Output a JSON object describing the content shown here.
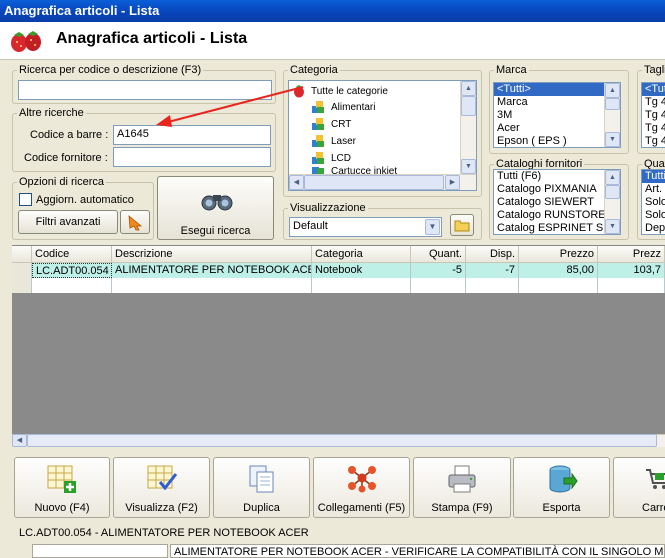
{
  "window": {
    "title": "Anagrafica articoli  - Lista"
  },
  "header": {
    "title": "Anagrafica articoli  - Lista"
  },
  "search": {
    "code_desc_legend": "Ricerca per codice o descrizione (F3)",
    "code_desc_value": "",
    "other_legend": "Altre ricerche",
    "barcode_label": "Codice a barre :",
    "barcode_value": "A1645",
    "supplier_code_label": "Codice fornitore :",
    "supplier_code_value": ""
  },
  "options": {
    "legend": "Opzioni di ricerca",
    "auto_update_label": "Aggiorn. automatico",
    "auto_update_checked": false,
    "advanced_filters_label": "Filtri avanzati"
  },
  "run_search_label": "Esegui ricerca",
  "category": {
    "legend": "Categoria",
    "root": "Tutte le categorie",
    "items": [
      "Alimentari",
      "CRT",
      "Laser",
      "LCD",
      "Cartucce inkjet"
    ]
  },
  "display": {
    "legend": "Visualizzazione",
    "selected": "Default"
  },
  "brand": {
    "legend": "Marca",
    "items": [
      "<Tutti>",
      "Marca",
      "3M",
      "Acer",
      "Epson ( EPS )"
    ],
    "selected_index": 0
  },
  "catalogs": {
    "legend": "Cataloghi fornitori",
    "items": [
      "Tutti (F6)",
      "Catalogo PIXMANIA",
      "Catalogo SIEWERT",
      "Catalogo RUNSTORE",
      "Catalog ESPRINET SPA"
    ]
  },
  "sizes": {
    "legend": "Tagli",
    "items": [
      "<Tutt",
      "Tg 4",
      "Tg 4",
      "Tg 4",
      "Tg 4"
    ],
    "selected_index": 0
  },
  "quantity": {
    "legend": "Quan",
    "items": [
      "Tutti",
      "Art.",
      "Solo",
      "Solo",
      "Depo"
    ],
    "selected_index": 0
  },
  "grid": {
    "columns": [
      "Codice",
      "Descrizione",
      "Categoria",
      "Quant.",
      "Disp.",
      "Prezzo",
      "Prezz"
    ],
    "rows": [
      {
        "codice": "LC.ADT00.054",
        "descrizione": "ALIMENTATORE PER NOTEBOOK ACER",
        "categoria": "Notebook",
        "quant": "-5",
        "disp": "-7",
        "prezzo": "85,00",
        "prezzo2": "103,7"
      }
    ]
  },
  "toolbar": {
    "new_label": "Nuovo (F4)",
    "view_label": "Visualizza (F2)",
    "dup_label": "Duplica",
    "links_label": "Collegamenti (F5)",
    "print_label": "Stampa (F9)",
    "export_label": "Esporta",
    "cart_label": "Carre"
  },
  "detail": {
    "title": "LC.ADT00.054 - ALIMENTATORE PER NOTEBOOK ACER",
    "description": "ALIMENTATORE PER NOTEBOOK ACER - VERIFICARE LA COMPATIBILITÀ CON IL SINGOLO MODELLO"
  }
}
